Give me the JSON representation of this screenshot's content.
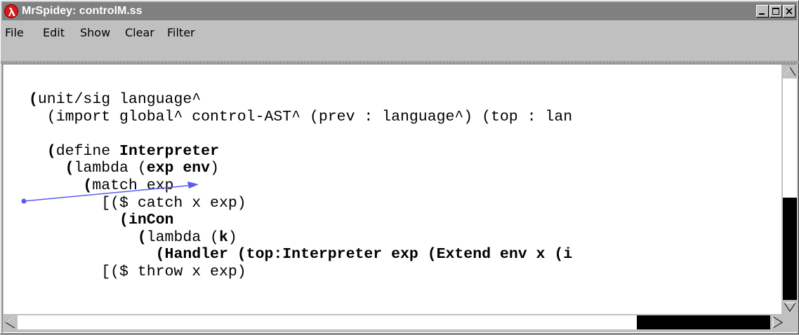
{
  "window": {
    "title": "MrSpidey: controlM.ss",
    "app_icon": "lambda-icon",
    "controls": [
      "minimize-icon",
      "maximize-icon",
      "close-icon"
    ]
  },
  "menubar": {
    "items": [
      "File",
      "Edit",
      "Show",
      "Clear",
      "Filter"
    ]
  },
  "code": {
    "lines": [
      [
        {
          "t": "(unit/sig language^",
          "b": false
        }
      ],
      [
        {
          "t": "  (import global^ control-AST^ (prev : language^) (top : lan",
          "b": false
        }
      ],
      [
        {
          "t": "",
          "b": false
        }
      ],
      [
        {
          "t": "  (define ",
          "b": false
        },
        {
          "t": "Interpreter",
          "b": true
        }
      ],
      [
        {
          "t": "    (lambda (",
          "b": false
        },
        {
          "t": "exp env",
          "b": true
        },
        {
          "t": ")",
          "b": false
        }
      ],
      [
        {
          "t": "      (match exp",
          "b": false
        }
      ],
      [
        {
          "t": "        [($ catch x exp)",
          "b": false
        }
      ],
      [
        {
          "t": "          (",
          "b": false
        },
        {
          "t": "inCon",
          "b": true
        }
      ],
      [
        {
          "t": "            (lambda (",
          "b": false
        },
        {
          "t": "k",
          "b": true
        },
        {
          "t": ")",
          "b": false
        }
      ],
      [
        {
          "t": "              ",
          "b": false
        },
        {
          "t": "(Handler (top:Interpreter exp (Extend env x (i",
          "b": true
        }
      ],
      [
        {
          "t": "        [($ throw x exp)",
          "b": false
        }
      ]
    ],
    "bold_parens_lines": [
      0,
      3,
      4,
      5,
      7,
      8
    ]
  },
  "colors": {
    "arrow": "#5a5af0",
    "titlebar": "#808080",
    "app_icon": "#d81818"
  }
}
